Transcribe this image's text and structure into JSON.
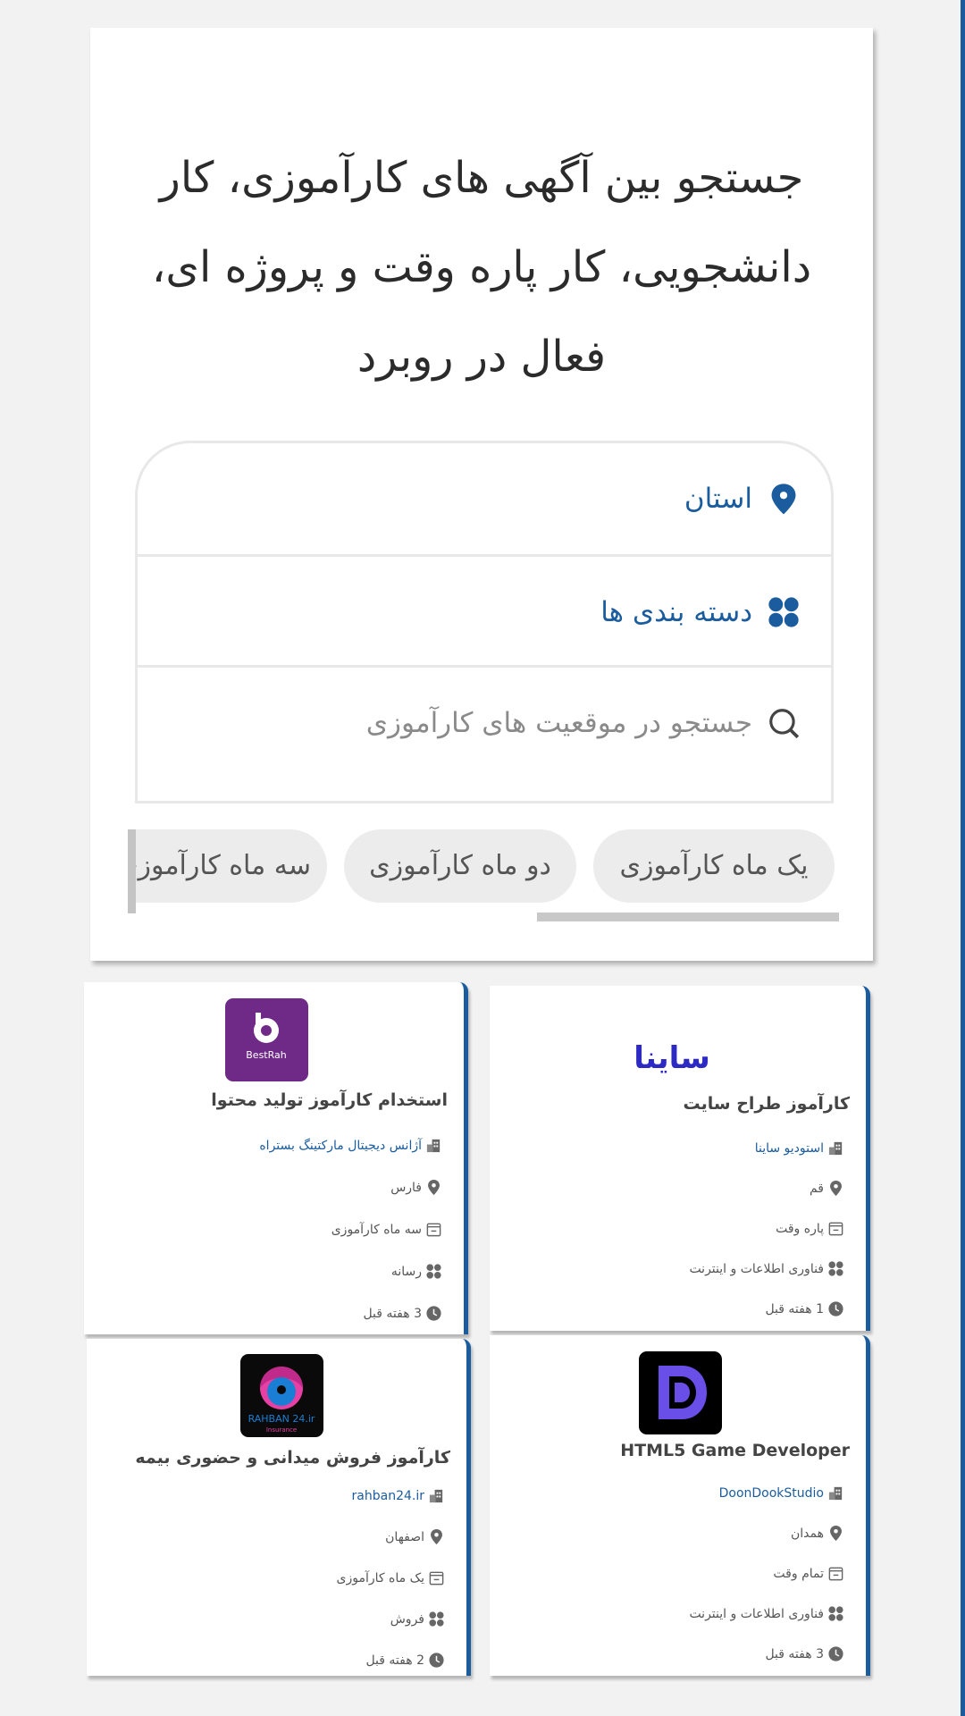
{
  "hero": {
    "title": "جستجو بین آگهی های کارآموزی، کار دانشجویی، کار پاره وقت و پروژه ای، فعال در روبرد"
  },
  "search": {
    "province_label": "استان",
    "category_label": "دسته بندی ها",
    "search_placeholder": "جستجو در موقعیت های کارآموزی"
  },
  "chips": [
    {
      "label": "یک ماه کارآموزی"
    },
    {
      "label": "دو ماه کارآموزی"
    },
    {
      "label": "سه ماه کارآموزی"
    }
  ],
  "jobs": [
    {
      "title": "کارآموز طراح سایت",
      "company": "استودیو ساینا",
      "location": "قم",
      "type": "پاره وقت",
      "category": "فناوری اطلاعات و اینترنت",
      "posted": "1 هفته قبل",
      "logo_text": "ساینا",
      "logo_color": "#2d2ac4"
    },
    {
      "title": "استخدام کارآموز تولید محتوا",
      "company": "آژانس دیجیتال مارکتینگ بستراه",
      "location": "فارس",
      "type": "سه ماه کارآموزی",
      "category": "رسانه",
      "posted": "3 هفته قبل",
      "logo_text": "BestRah",
      "logo_color": "#6e2a86"
    },
    {
      "title": "HTML5 Game Developer",
      "company": "DoonDookStudio",
      "location": "همدان",
      "type": "تمام وقت",
      "category": "فناوری اطلاعات و اینترنت",
      "posted": "3 هفته قبل",
      "logo_color": "#6a4ee8"
    },
    {
      "title": "کارآموز فروش میدانی و حضوری بیمه",
      "company": "rahban24.ir",
      "location": "اصفهان",
      "type": "یک ماه کارآموزی",
      "category": "فروش",
      "posted": "2 هفته قبل",
      "logo_text": "RAHBAN 24.ir",
      "logo_subtext": "Insurance",
      "logo_color": "#1a7fd4"
    }
  ],
  "colors": {
    "accent": "#1a5c9e",
    "background": "#f2f2f2",
    "chip_bg": "#ececec"
  },
  "icons": {
    "province": "map-pin-icon",
    "category": "grid-dots-icon",
    "search": "search-icon",
    "company": "building-icon",
    "location": "map-pin-icon",
    "type": "calendar-icon",
    "category_row": "grid-dots-icon",
    "posted": "clock-icon"
  }
}
